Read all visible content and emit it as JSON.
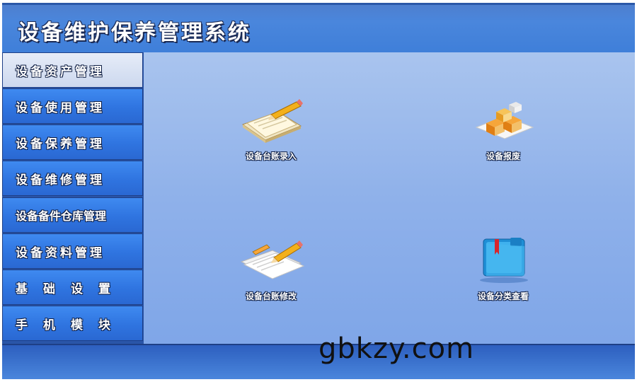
{
  "app": {
    "title": "设备维护保养管理系统"
  },
  "sidebar": {
    "items": [
      {
        "label": "设备资产管理",
        "active": true
      },
      {
        "label": "设备使用管理",
        "active": false
      },
      {
        "label": "设备保养管理",
        "active": false
      },
      {
        "label": "设备维修管理",
        "active": false
      },
      {
        "label": "设备备件仓库管理",
        "active": false
      },
      {
        "label": "设备资料管理",
        "active": false
      },
      {
        "label": "基础设置",
        "active": false
      },
      {
        "label": "手机模块",
        "active": false
      }
    ]
  },
  "main": {
    "tiles": [
      {
        "label": "设备台账录入",
        "icon": "notebook-pencil-icon"
      },
      {
        "label": "设备报废",
        "icon": "boxes-icon"
      },
      {
        "label": "设备台账修改",
        "icon": "paper-pencil-icon"
      },
      {
        "label": "设备分类查看",
        "icon": "blue-folder-icon"
      }
    ]
  },
  "watermark": "gbkzy.com",
  "colors": {
    "title_bar": "#4a86dc",
    "nav_item": "#2f74e0",
    "nav_active": "#dce4f4",
    "content_bg": "#8fb1ea"
  }
}
